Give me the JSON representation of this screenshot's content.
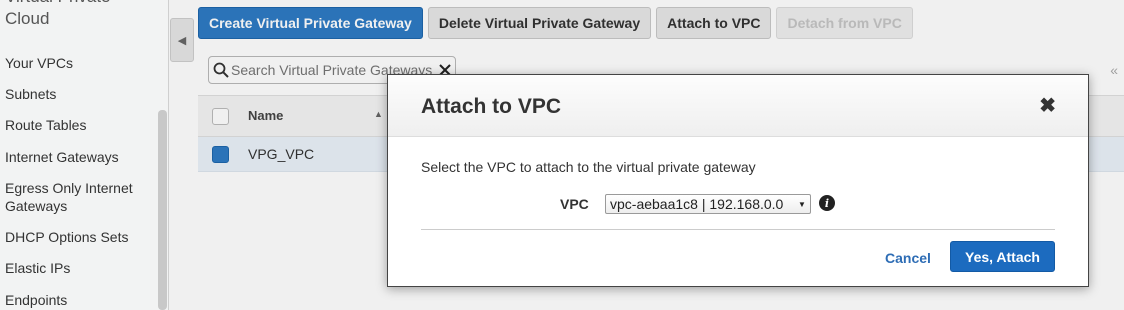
{
  "sidebar": {
    "section_title": "Virtual Private Cloud",
    "items": [
      {
        "label": "Your VPCs"
      },
      {
        "label": "Subnets"
      },
      {
        "label": "Route Tables"
      },
      {
        "label": "Internet Gateways"
      },
      {
        "label": "Egress Only Internet Gateways"
      },
      {
        "label": "DHCP Options Sets"
      },
      {
        "label": "Elastic IPs"
      },
      {
        "label": "Endpoints"
      }
    ]
  },
  "toolbar": {
    "create_label": "Create Virtual Private Gateway",
    "delete_label": "Delete Virtual Private Gateway",
    "attach_label": "Attach to VPC",
    "detach_label": "Detach from VPC"
  },
  "search": {
    "placeholder": "Search Virtual Private Gateways"
  },
  "table": {
    "columns": [
      "Name"
    ],
    "rows": [
      {
        "name": "VPG_VPC",
        "selected": true
      }
    ]
  },
  "modal": {
    "title": "Attach to VPC",
    "description": "Select the VPC to attach to the virtual private gateway",
    "vpc_label": "VPC",
    "vpc_selected": "vpc-aebaa1c8 | 192.168.0.0",
    "cancel_label": "Cancel",
    "confirm_label": "Yes, Attach"
  },
  "colors": {
    "primary": "#2e7bc4",
    "link": "#2e6db5",
    "selected_row": "#eaf2f9"
  }
}
